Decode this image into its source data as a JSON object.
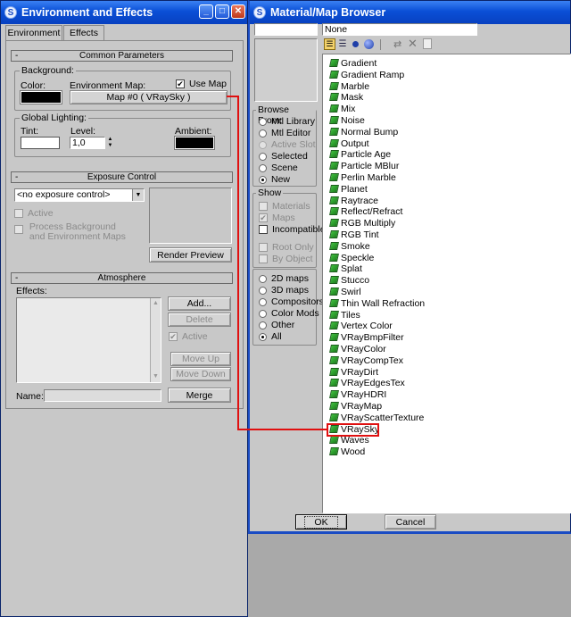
{
  "env_window": {
    "title": "Environment and Effects",
    "tabs": [
      "Environment",
      "Effects"
    ],
    "common": {
      "header": "Common Parameters",
      "background_group": "Background:",
      "color_label": "Color:",
      "env_map_label": "Environment Map:",
      "use_map_label": "Use Map",
      "map_button": "Map #0  ( VRaySky )",
      "global_lighting_group": "Global Lighting:",
      "tint_label": "Tint:",
      "level_label": "Level:",
      "level_value": "1,0",
      "ambient_label": "Ambient:"
    },
    "exposure": {
      "header": "Exposure Control",
      "dropdown_value": "<no exposure control>",
      "active_label": "Active",
      "process_label_1": "Process Background",
      "process_label_2": "and Environment Maps",
      "render_preview": "Render Preview"
    },
    "atmosphere": {
      "header": "Atmosphere",
      "effects_label": "Effects:",
      "add": "Add...",
      "delete": "Delete",
      "active": "Active",
      "move_up": "Move Up",
      "move_down": "Move Down",
      "name_label": "Name:",
      "merge": "Merge"
    },
    "colors": {
      "background_swatch": "#000000",
      "tint_swatch": "#ffffff",
      "ambient_swatch": "#000000"
    }
  },
  "browser_window": {
    "title": "Material/Map Browser",
    "current_name": "None",
    "browse_from": {
      "label": "Browse From:",
      "options": [
        {
          "label": "Mtl Library",
          "enabled": true,
          "selected": false
        },
        {
          "label": "Mtl Editor",
          "enabled": true,
          "selected": false
        },
        {
          "label": "Active Slot",
          "enabled": false,
          "selected": false
        },
        {
          "label": "Selected",
          "enabled": true,
          "selected": false
        },
        {
          "label": "Scene",
          "enabled": true,
          "selected": false
        },
        {
          "label": "New",
          "enabled": true,
          "selected": true
        }
      ]
    },
    "show": {
      "label": "Show",
      "options": [
        {
          "label": "Materials",
          "enabled": false,
          "checked": false
        },
        {
          "label": "Maps",
          "enabled": false,
          "checked": true
        },
        {
          "label": "Incompatible",
          "enabled": true,
          "checked": false
        }
      ],
      "root_only": "Root Only",
      "by_object": "By Object"
    },
    "map_types": [
      {
        "label": "2D maps",
        "selected": false
      },
      {
        "label": "3D maps",
        "selected": false
      },
      {
        "label": "Compositors",
        "selected": false
      },
      {
        "label": "Color Mods",
        "selected": false
      },
      {
        "label": "Other",
        "selected": false
      },
      {
        "label": "All",
        "selected": true
      }
    ],
    "maps": [
      "Gradient",
      "Gradient Ramp",
      "Marble",
      "Mask",
      "Mix",
      "Noise",
      "Normal Bump",
      "Output",
      "Particle Age",
      "Particle MBlur",
      "Perlin Marble",
      "Planet",
      "Raytrace",
      "Reflect/Refract",
      "RGB Multiply",
      "RGB Tint",
      "Smoke",
      "Speckle",
      "Splat",
      "Stucco",
      "Swirl",
      "Thin Wall Refraction",
      "Tiles",
      "Vertex Color",
      "VRayBmpFilter",
      "VRayColor",
      "VRayCompTex",
      "VRayDirt",
      "VRayEdgesTex",
      "VRayHDRI",
      "VRayMap",
      "VRayScatterTexture",
      "VRaySky",
      "Waves",
      "Wood"
    ],
    "highlighted_map": "VRaySky",
    "ok": "OK",
    "cancel": "Cancel",
    "highlight_color": "#e01010"
  }
}
